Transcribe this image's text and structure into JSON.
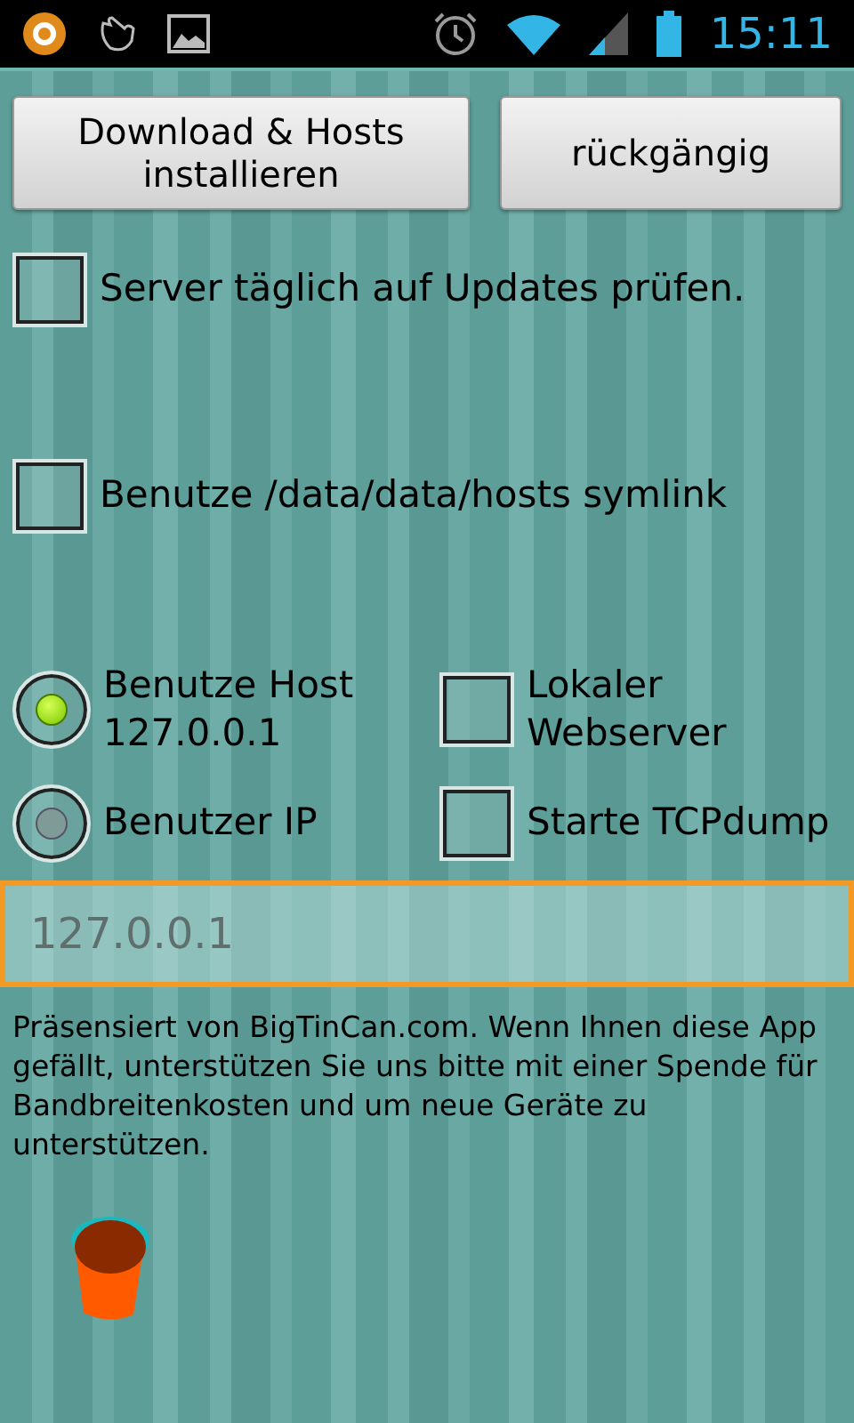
{
  "status_bar": {
    "time": "15:11"
  },
  "buttons": [
    {
      "label": "Download & Hosts installieren"
    },
    {
      "label": "rückgängig"
    }
  ],
  "options": [
    {
      "label": "Server täglich auf Updates prüfen.",
      "checked": false
    },
    {
      "label": "Benutze /data/data/hosts symlink",
      "checked": false
    }
  ],
  "host_choice": [
    {
      "label": "Benutze Host 127.0.0.1",
      "selected": true
    },
    {
      "label": "Benutzer IP",
      "selected": false
    }
  ],
  "server_options": [
    {
      "label": "Lokaler Webserver",
      "checked": false
    },
    {
      "label": "Starte TCPdump",
      "checked": false
    }
  ],
  "ip_field": {
    "placeholder": "127.0.0.1"
  },
  "footer_text": "Präsensiert von BigTinCan.com. Wenn Ihnen diese App gefällt, unterstützen Sie uns bitte mit einer Spende für Bandbreitenkosten und um neue Geräte zu unterstützen."
}
